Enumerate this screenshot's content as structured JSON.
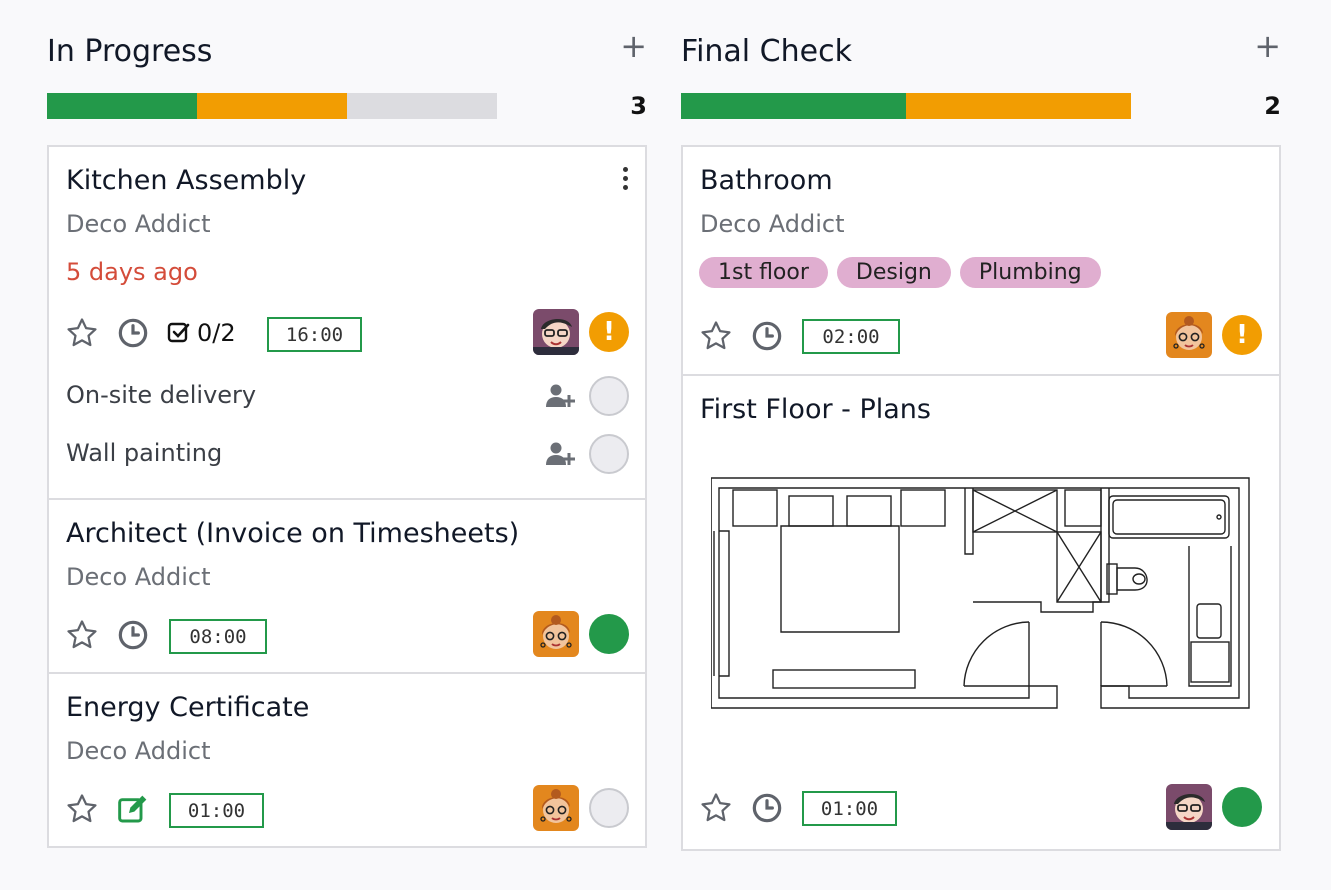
{
  "columns": [
    {
      "title": "In Progress",
      "count": "3",
      "progress": {
        "green": 0.3333,
        "orange": 0.3333,
        "grey": 0.3334
      },
      "cards": [
        {
          "title": "Kitchen Assembly",
          "customer": "Deco Addict",
          "deadline": "5 days ago",
          "checklist": "0/2",
          "time": "16:00",
          "status": "orange",
          "subtasks": [
            "On-site delivery",
            "Wall painting"
          ]
        },
        {
          "title": "Architect (Invoice on Timesheets)",
          "customer": "Deco Addict",
          "time": "08:00",
          "status": "green"
        },
        {
          "title": "Energy Certificate",
          "customer": "Deco Addict",
          "time": "01:00",
          "status": "grey"
        }
      ]
    },
    {
      "title": "Final Check",
      "count": "2",
      "progress": {
        "green": 0.5,
        "orange": 0.5,
        "grey": 0
      },
      "cards": [
        {
          "title": "Bathroom",
          "customer": "Deco Addict",
          "tags": [
            "1st floor",
            "Design",
            "Plumbing"
          ],
          "time": "02:00",
          "status": "orange"
        },
        {
          "title": "First Floor - Plans",
          "time": "01:00",
          "status": "green"
        }
      ]
    }
  ],
  "colors": {
    "green": "#23994a",
    "orange": "#f29d02",
    "grey": "#dcdce0",
    "deadline_red": "#d44c3a",
    "tag_pink": "#e0aed0"
  },
  "icons": {
    "add": "+",
    "priority": "!"
  }
}
